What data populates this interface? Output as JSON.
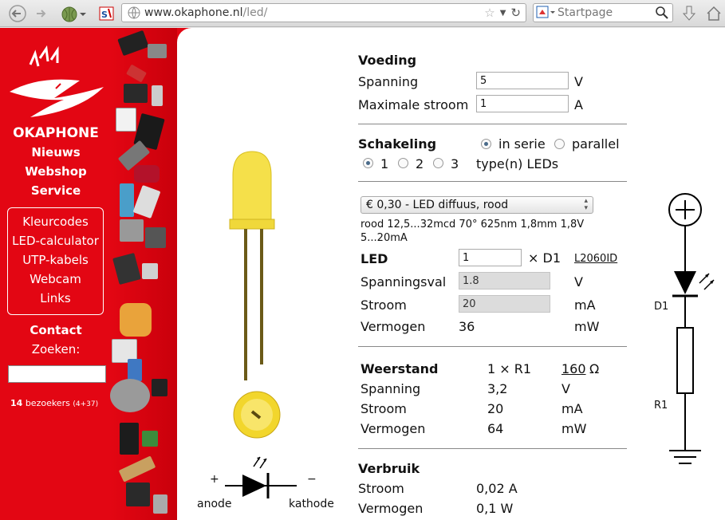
{
  "browser": {
    "url_host": "www.okaphone.nl",
    "url_path": "/led/",
    "search_engine_placeholder": "Startpage"
  },
  "sidebar": {
    "brand": "OKAPHONE",
    "nav": [
      "Nieuws",
      "Webshop",
      "Service"
    ],
    "box_links": [
      "Kleurcodes",
      "LED-calculator",
      "UTP-kabels",
      "Webcam",
      "Links"
    ],
    "contact": "Contact",
    "search_label": "Zoeken:",
    "visitors_count": "14",
    "visitors_text": "bezoekers",
    "visitors_extra": "(4+37)"
  },
  "diagram": {
    "plus": "+",
    "minus": "−",
    "anode": "anode",
    "kathode": "kathode",
    "d1": "D1",
    "r1": "R1"
  },
  "voeding": {
    "title": "Voeding",
    "spanning_label": "Spanning",
    "spanning_value": "5",
    "spanning_unit": "V",
    "stroom_label": "Maximale stroom",
    "stroom_value": "1",
    "stroom_unit": "A"
  },
  "schakeling": {
    "title": "Schakeling",
    "serie": "in serie",
    "parallel": "parallel",
    "opt1": "1",
    "opt2": "2",
    "opt3": "3",
    "types": "type(n) LEDs"
  },
  "led": {
    "select": "€ 0,30 - LED diffuus, rood",
    "desc_line1": "rood 12,5...32mcd 70° 625nm 1,8mm 1,8V",
    "desc_line2": "5...20mA",
    "title": "LED",
    "count": "1",
    "count_suffix": "× D1",
    "code": "L2060ID",
    "spanningsval_label": "Spanningsval",
    "spanningsval_value": "1.8",
    "spanningsval_unit": "V",
    "stroom_label": "Stroom",
    "stroom_value": "20",
    "stroom_unit": "mA",
    "vermogen_label": "Vermogen",
    "vermogen_value": "36",
    "vermogen_unit": "mW"
  },
  "weerstand": {
    "title": "Weerstand",
    "count": "1 × R1",
    "value": "160",
    "unit": "Ω",
    "spanning_label": "Spanning",
    "spanning_value": "3,2",
    "spanning_unit": "V",
    "stroom_label": "Stroom",
    "stroom_value": "20",
    "stroom_unit": "mA",
    "vermogen_label": "Vermogen",
    "vermogen_value": "64",
    "vermogen_unit": "mW"
  },
  "verbruik": {
    "title": "Verbruik",
    "stroom_label": "Stroom",
    "stroom_value": "0,02 A",
    "vermogen_label": "Vermogen",
    "vermogen_value": "0,1 W"
  },
  "colors": {
    "brand_red": "#e30613",
    "led_yellow": "#f5e04a"
  }
}
